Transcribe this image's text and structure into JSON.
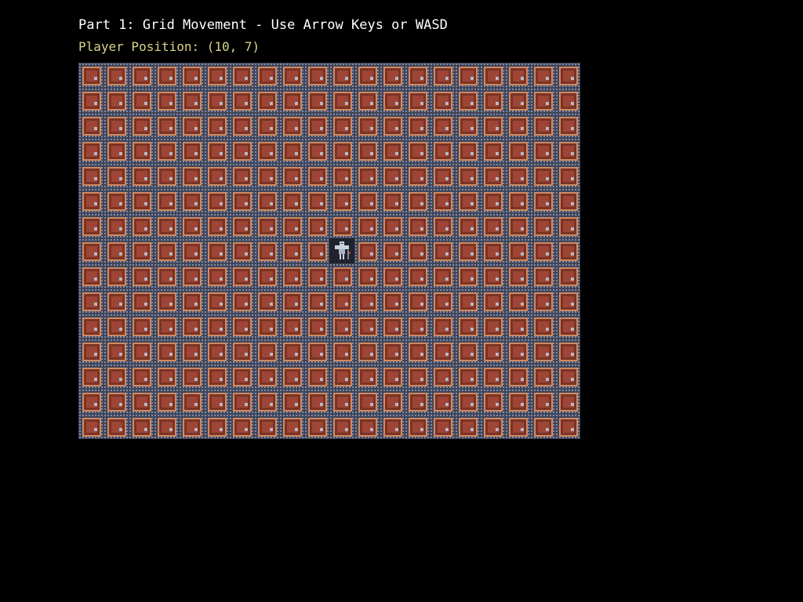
{
  "header": {
    "title": "Part 1: Grid Movement - Use Arrow Keys or WASD",
    "position_text": "Player Position: (10, 7)"
  },
  "grid": {
    "columns": 20,
    "rows": 15
  },
  "player": {
    "x": 10,
    "y": 7
  },
  "colors": {
    "background": "#000000",
    "title_text": "#ffffff",
    "position_text": "#d8d48a",
    "floor_tile": "#9e4535",
    "floor_border": "#cf8a62",
    "wall_stone": "#3f455a",
    "player_armor": "#c9d1dc"
  },
  "icons": {
    "player": "knight-icon",
    "tile": "floor-tile"
  }
}
